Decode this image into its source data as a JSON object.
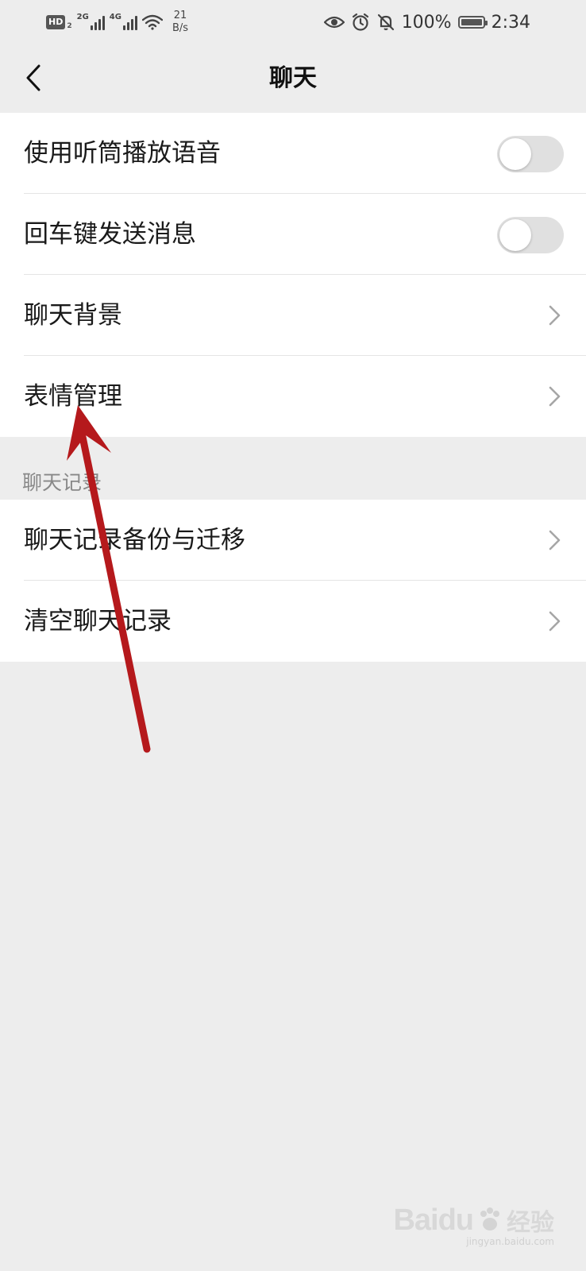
{
  "status_bar": {
    "hd_label": "HD",
    "hd_sub": "2",
    "signal1_label": "2G",
    "signal2_label": "4G",
    "speed_value": "21",
    "speed_unit": "B/s",
    "battery_percent": "100%",
    "battery_level": 1.0,
    "time": "2:34"
  },
  "header": {
    "title": "聊天"
  },
  "settings": {
    "items": [
      {
        "label": "使用听筒播放语音",
        "control": "toggle",
        "on": false
      },
      {
        "label": "回车键发送消息",
        "control": "toggle",
        "on": false
      },
      {
        "label": "聊天背景",
        "control": "chevron"
      },
      {
        "label": "表情管理",
        "control": "chevron"
      }
    ]
  },
  "history": {
    "section_title": "聊天记录",
    "items": [
      {
        "label": "聊天记录备份与迁移",
        "control": "chevron"
      },
      {
        "label": "清空聊天记录",
        "control": "chevron"
      }
    ]
  },
  "watermark": {
    "brand": "Baidu",
    "cn": "经验",
    "url": "jingyan.baidu.com"
  },
  "colors": {
    "background": "#ededed",
    "row_background": "#ffffff",
    "toggle_off": "#e0e0e0",
    "annotation_arrow": "#b5191c"
  }
}
